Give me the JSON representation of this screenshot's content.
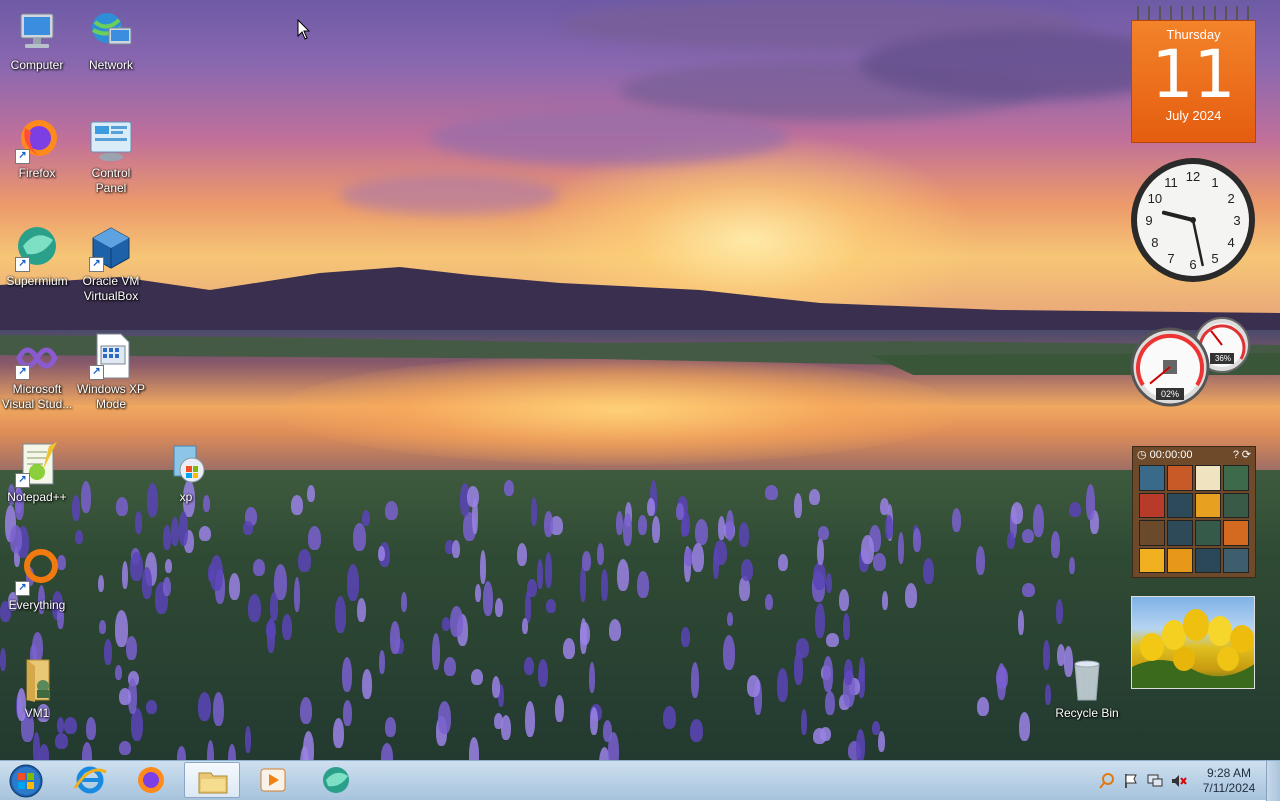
{
  "desktop": {
    "icons": [
      {
        "label": "Computer",
        "icon": "computer-icon"
      },
      {
        "label": "Network",
        "icon": "network-icon"
      },
      {
        "label": "Firefox",
        "icon": "firefox-icon"
      },
      {
        "label": "Control Panel",
        "icon": "control-panel-icon"
      },
      {
        "label": "Supermium",
        "icon": "supermium-icon"
      },
      {
        "label": "Oracle VM VirtualBox",
        "icon": "virtualbox-icon"
      },
      {
        "label": "Microsoft Visual Stud...",
        "icon": "visual-studio-icon"
      },
      {
        "label": "Windows XP Mode",
        "icon": "windows-xp-mode-icon"
      },
      {
        "label": "Notepad++",
        "icon": "notepad-plus-plus-icon"
      },
      {
        "label": "xp",
        "icon": "xp-installer-icon"
      },
      {
        "label": "Everything",
        "icon": "everything-search-icon"
      },
      {
        "label": "VM1",
        "icon": "folder-icon"
      },
      {
        "label": "Recycle Bin",
        "icon": "recycle-bin-icon"
      }
    ]
  },
  "gadgets": {
    "calendar": {
      "weekday": "Thursday",
      "day": "11",
      "month_year": "July 2024"
    },
    "clock": {
      "hour": 9,
      "minute": 28
    },
    "cpu_meter": {
      "cpu": "02%",
      "memory": "36%",
      "cpu_fraction": 0.02,
      "memory_fraction": 0.36
    },
    "puzzle": {
      "timer": "00:00:00"
    }
  },
  "taskbar": {
    "start": "start-orb-icon",
    "pinned": [
      {
        "name": "internet-explorer-icon"
      },
      {
        "name": "firefox-icon"
      },
      {
        "name": "file-explorer-icon",
        "active": true
      },
      {
        "name": "media-player-icon"
      },
      {
        "name": "supermium-icon"
      }
    ],
    "tray": [
      "search-icon",
      "action-center-flag-icon",
      "network-icon",
      "volume-muted-icon"
    ],
    "time": "9:28 AM",
    "date": "7/11/2024"
  },
  "colors": {
    "calendar_orange": "#ee6f1c",
    "taskbar": "#b9d1e6",
    "desktop_text": "#ffffff"
  }
}
